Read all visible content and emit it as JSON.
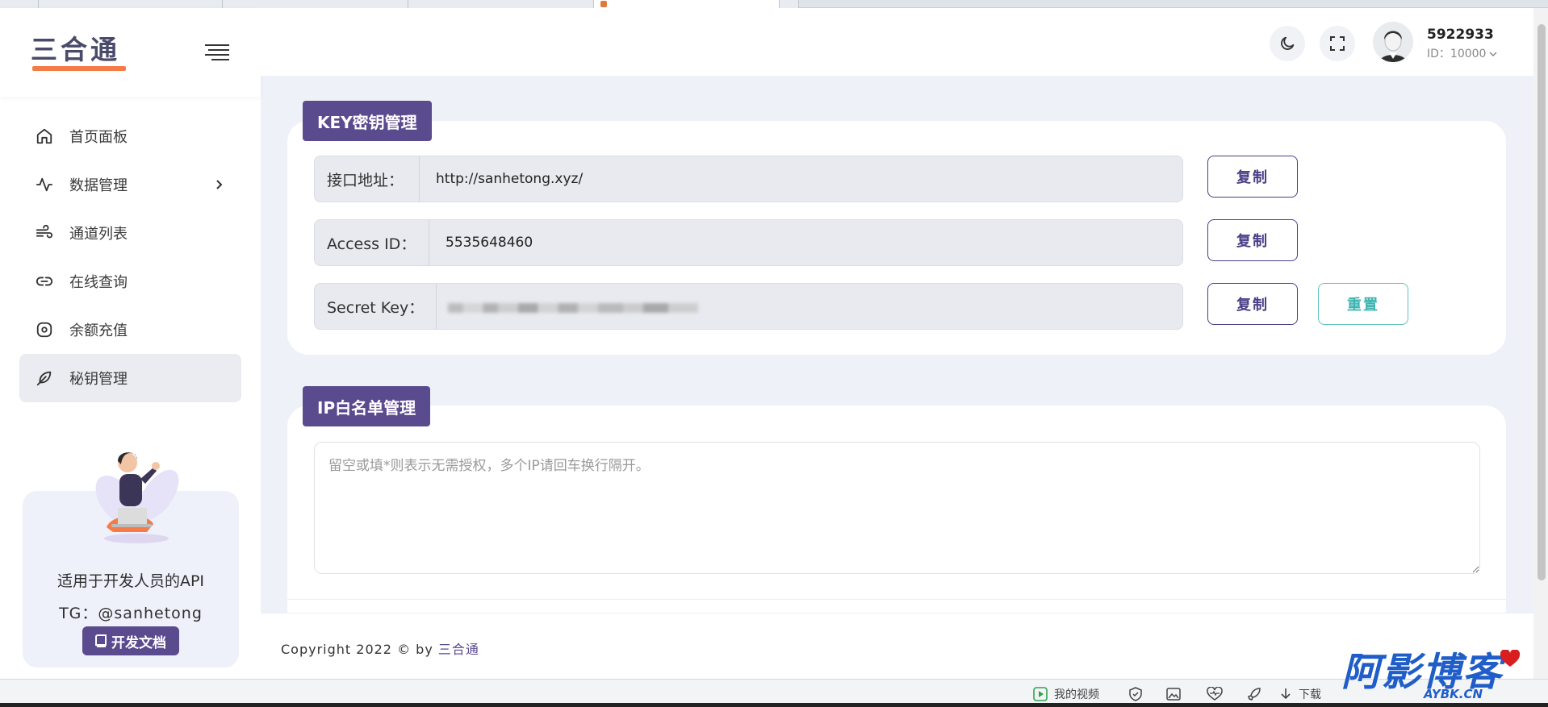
{
  "sidebar": {
    "logo_text": "三合通",
    "items": [
      {
        "label": "首页面板",
        "icon": "home-icon"
      },
      {
        "label": "数据管理",
        "icon": "activity-icon"
      },
      {
        "label": "通道列表",
        "icon": "wind-icon"
      },
      {
        "label": "在线查询",
        "icon": "link-icon"
      },
      {
        "label": "余额充值",
        "icon": "target-icon"
      },
      {
        "label": "秘钥管理",
        "icon": "feather-icon"
      }
    ],
    "active_index": 5,
    "promo": {
      "title": "适用于开发人员的API",
      "tg": "TG：@sanhetong",
      "doc_button": "开发文档"
    }
  },
  "header": {
    "username": "5922933",
    "user_id": "ID：10000"
  },
  "key_card": {
    "tag": "KEY密钥管理",
    "api_label": "接口地址：",
    "api_value": "http://sanhetong.xyz/",
    "access_label": "Access ID：",
    "access_value": "5535648460",
    "secret_label": "Secret Key：",
    "copy_label": "复制",
    "reset_label": "重置"
  },
  "ip_card": {
    "tag": "IP白名单管理",
    "placeholder": "留空或填*则表示无需授权，多个IP请回车换行隔开。"
  },
  "footer": {
    "copyright": "Copyright 2022 © by ",
    "link_text": "三合通"
  },
  "statusbar": {
    "my_video": "我的视频",
    "download": "下载"
  },
  "watermark": {
    "text": "阿影博客",
    "sub": "AYBK.CN"
  },
  "colors": {
    "primary": "#5a4a8e",
    "reset": "#3ab4b0",
    "accent": "#f47c48"
  }
}
